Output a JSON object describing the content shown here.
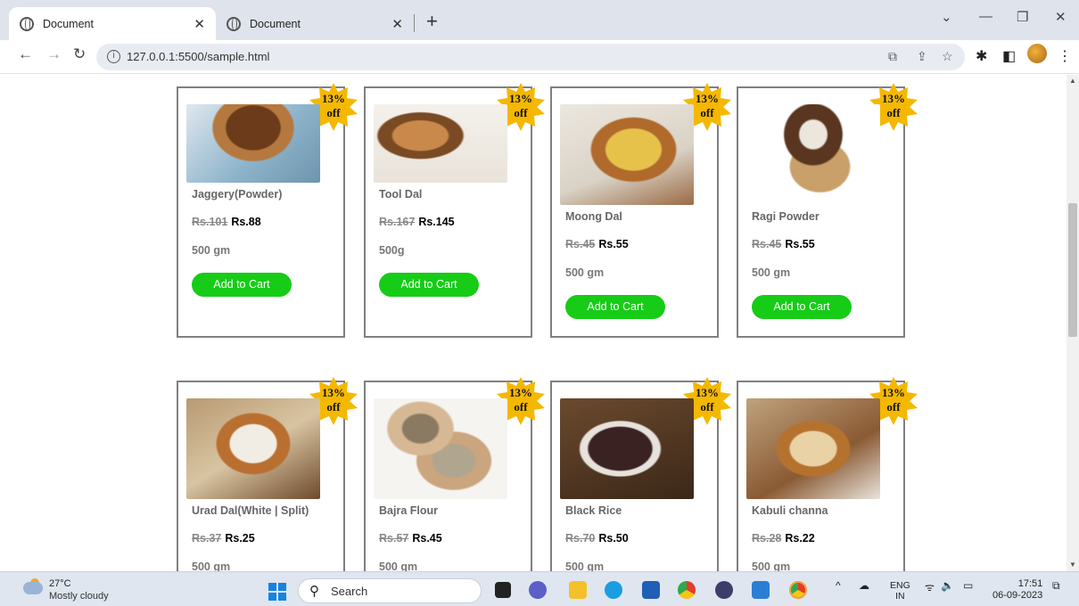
{
  "browser": {
    "tabs": [
      {
        "title": "Document"
      },
      {
        "title": "Document"
      }
    ],
    "url": "127.0.0.1:5500/sample.html"
  },
  "colors": {
    "add_to_cart": "#16cc16",
    "badge": "#f5b800",
    "card_border": "#808080"
  },
  "products": [
    {
      "name": "Jaggery(Powder)",
      "old_price": "Rs.101",
      "new_price": "Rs.88",
      "quantity": "500 gm",
      "badge_pct": "13%",
      "badge_off": "off",
      "button": "Add to Cart"
    },
    {
      "name": "Tool Dal",
      "old_price": "Rs.167",
      "new_price": "Rs.145",
      "quantity": "500g",
      "badge_pct": "13%",
      "badge_off": "off",
      "button": "Add to Cart"
    },
    {
      "name": "Moong Dal",
      "old_price": "Rs.45",
      "new_price": "Rs.55",
      "quantity": "500 gm",
      "badge_pct": "13%",
      "badge_off": "off",
      "button": "Add to Cart"
    },
    {
      "name": "Ragi Powder",
      "old_price": "Rs.45",
      "new_price": "Rs.55",
      "quantity": "500 gm",
      "badge_pct": "13%",
      "badge_off": "off",
      "button": "Add to Cart"
    },
    {
      "name": "Urad Dal(White | Split)",
      "old_price": "Rs.37",
      "new_price": "Rs.25",
      "quantity": "500 gm",
      "badge_pct": "13%",
      "badge_off": "off"
    },
    {
      "name": "Bajra Flour",
      "old_price": "Rs.57",
      "new_price": "Rs.45",
      "quantity": "500 gm",
      "badge_pct": "13%",
      "badge_off": "off"
    },
    {
      "name": "Black Rice",
      "old_price": "Rs.70",
      "new_price": "Rs.50",
      "quantity": "500 gm",
      "badge_pct": "13%",
      "badge_off": "off"
    },
    {
      "name": "Kabuli channa",
      "old_price": "Rs.28",
      "new_price": "Rs.22",
      "quantity": "500 gm",
      "badge_pct": "13%",
      "badge_off": "off"
    }
  ],
  "taskbar": {
    "weather_temp": "27°C",
    "weather_desc": "Mostly cloudy",
    "search_placeholder": "Search",
    "lang_line1": "ENG",
    "lang_line2": "IN",
    "time": "17:51",
    "date": "06-09-2023"
  }
}
